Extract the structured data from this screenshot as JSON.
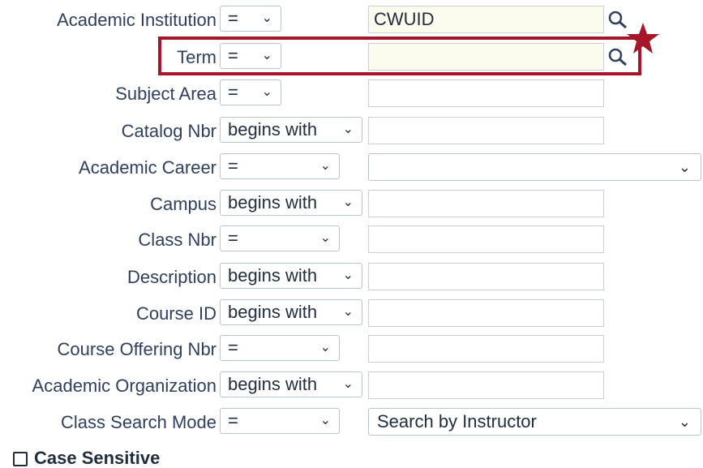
{
  "rows": [
    {
      "label": "Academic Institution",
      "operator": "=",
      "value": "CWUID"
    },
    {
      "label": "Term",
      "operator": "=",
      "value": ""
    },
    {
      "label": "Subject Area",
      "operator": "=",
      "value": ""
    },
    {
      "label": "Catalog Nbr",
      "operator": "begins with",
      "value": ""
    },
    {
      "label": "Academic Career",
      "operator": "=",
      "value": ""
    },
    {
      "label": "Campus",
      "operator": "begins with",
      "value": ""
    },
    {
      "label": "Class Nbr",
      "operator": "=",
      "value": ""
    },
    {
      "label": "Description",
      "operator": "begins with",
      "value": ""
    },
    {
      "label": "Course ID",
      "operator": "begins with",
      "value": ""
    },
    {
      "label": "Course Offering Nbr",
      "operator": "=",
      "value": ""
    },
    {
      "label": "Academic Organization",
      "operator": "begins with",
      "value": ""
    },
    {
      "label": "Class Search Mode",
      "operator": "=",
      "value": "Search by Instructor"
    }
  ],
  "case_sensitive": {
    "label": "Case Sensitive",
    "checked": false
  },
  "icons": {
    "lookup": "magnifier-lookup-icon",
    "chevron": "chevron-down-icon",
    "marker": "star-icon"
  },
  "colors": {
    "highlight": "#a5162b",
    "label_text": "#2f3f5e"
  }
}
